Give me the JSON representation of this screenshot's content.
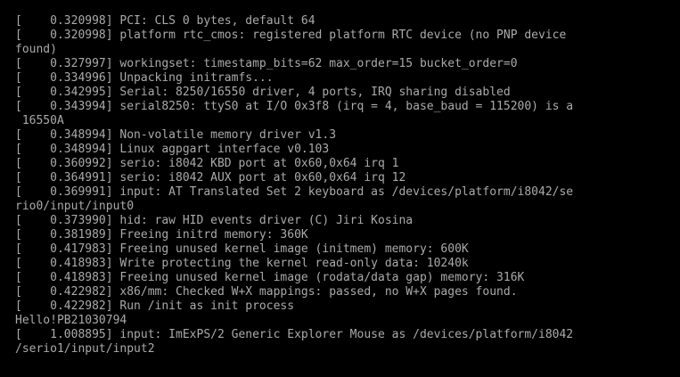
{
  "terminal": {
    "lines": [
      "[    0.320998] PCI: CLS 0 bytes, default 64",
      "[    0.320998] platform rtc_cmos: registered platform RTC device (no PNP device",
      "found)",
      "[    0.327997] workingset: timestamp_bits=62 max_order=15 bucket_order=0",
      "[    0.334996] Unpacking initramfs...",
      "[    0.342995] Serial: 8250/16550 driver, 4 ports, IRQ sharing disabled",
      "[    0.343994] serial8250: ttyS0 at I/O 0x3f8 (irq = 4, base_baud = 115200) is a",
      " 16550A",
      "[    0.348994] Non-volatile memory driver v1.3",
      "[    0.348994] Linux agpgart interface v0.103",
      "[    0.360992] serio: i8042 KBD port at 0x60,0x64 irq 1",
      "[    0.364991] serio: i8042 AUX port at 0x60,0x64 irq 12",
      "[    0.369991] input: AT Translated Set 2 keyboard as /devices/platform/i8042/se",
      "rio0/input/input0",
      "[    0.373990] hid: raw HID events driver (C) Jiri Kosina",
      "[    0.381989] Freeing initrd memory: 360K",
      "[    0.417983] Freeing unused kernel image (initmem) memory: 600K",
      "[    0.418983] Write protecting the kernel read-only data: 10240k",
      "[    0.418983] Freeing unused kernel image (rodata/data gap) memory: 316K",
      "[    0.422982] x86/mm: Checked W+X mappings: passed, no W+X pages found.",
      "[    0.422982] Run /init as init process",
      "Hello!PB21030794",
      "[    1.008895] input: ImExPS/2 Generic Explorer Mouse as /devices/platform/i8042",
      "/serio1/input/input2"
    ]
  }
}
